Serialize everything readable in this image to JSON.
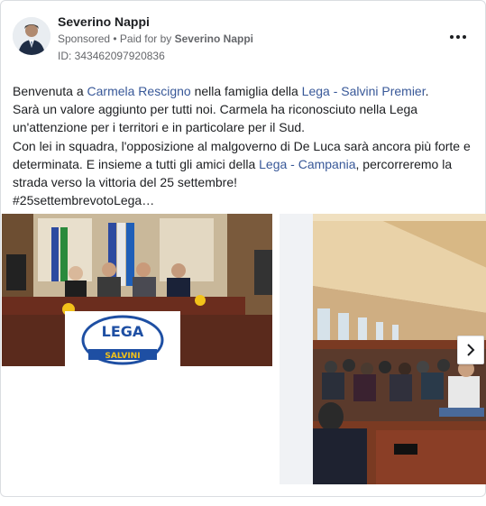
{
  "post": {
    "author": "Severino Nappi",
    "sponsored": "Sponsored",
    "separator": " • ",
    "paid_for_prefix": "Paid for by ",
    "paid_for_name": "Severino Nappi",
    "ad_id": "ID: 343462097920836"
  },
  "text": {
    "l1_a": "Benvenuta a ",
    "l1_link1": "Carmela Rescigno",
    "l1_b": " nella famiglia della ",
    "l1_link2": "Lega - Salvini Premier",
    "l1_c": ".",
    "l2": "Sarà un valore aggiunto per tutti noi. Carmela ha riconosciuto nella Lega",
    "l3": "un'attenzione per i territori e in particolare per il Sud.",
    "l4": "Con lei in squadra, l'opposizione al malgoverno di De Luca sarà ancora più forte e",
    "l5_a": "determinata. E insieme a tutti gli amici della ",
    "l5_link": "Lega - Campania",
    "l5_b": ", percorreremo la",
    "l6": "strada verso la vittoria del 25 settembre!",
    "l7": "#25settembrevotoLega…"
  },
  "media": {
    "banner_text_top": "LEGA",
    "banner_text_bottom": "SALVINI",
    "next_icon": "chevron-right-icon"
  },
  "colors": {
    "link": "#385898",
    "muted": "#65676b",
    "border": "#dadde1"
  }
}
